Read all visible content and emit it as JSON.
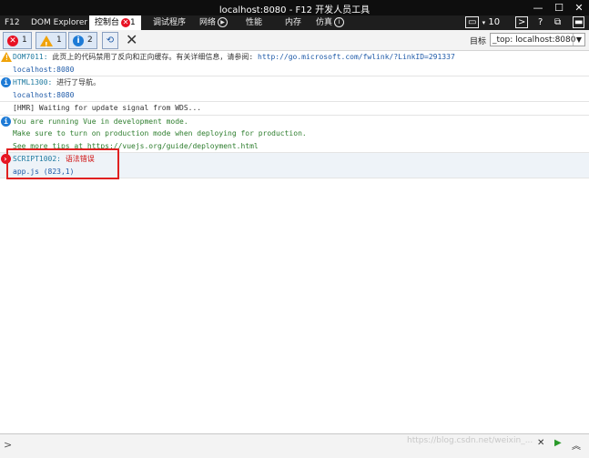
{
  "window": {
    "title": "localhost:8080 - F12 开发人员工具",
    "controls": {
      "minimize": "—",
      "maximize": "☐",
      "close": "✕"
    }
  },
  "tabs": {
    "items": [
      {
        "label": "F12"
      },
      {
        "label": "DOM Explorer"
      },
      {
        "label": "控制台",
        "badge": "1"
      },
      {
        "label": "调试程序"
      },
      {
        "label": "网络"
      },
      {
        "label": "性能"
      },
      {
        "label": "内存"
      },
      {
        "label": "仿真"
      }
    ],
    "emulation_mode": "10",
    "help": "?"
  },
  "toolbar": {
    "errors_count": "1",
    "warnings_count": "1",
    "info_count": "2",
    "target_label": "目标",
    "target_value": "_top: localhost:8080"
  },
  "console": {
    "messages": [
      {
        "type": "warning",
        "code": "DOM7011",
        "text": "此页上的代码禁用了反向和正向缓存。有关详细信息，请参阅:",
        "link": "http://go.microsoft.com/fwlink/?LinkID=291337",
        "source": "localhost:8080"
      },
      {
        "type": "info",
        "code": "HTML1300",
        "text": "进行了导航。",
        "source": "localhost:8080"
      },
      {
        "type": "log",
        "text": "[HMR] Waiting for update signal from WDS..."
      },
      {
        "type": "info",
        "lines": [
          "You are running Vue in development mode.",
          "Make sure to turn on production mode when deploying for production.",
          "See more tips at https://vuejs.org/guide/deployment.html"
        ]
      },
      {
        "type": "error",
        "code": "SCRIPT1002",
        "text": "语法错误",
        "source": "app.js (823,1)"
      }
    ]
  },
  "inputbar": {
    "prompt": ">",
    "watermark": "https://blog.csdn.net/weixin_..."
  },
  "colors": {
    "titlebar_bg": "#0e0e0e",
    "tabbar_bg": "#1e1e1e",
    "error_red": "#e81123",
    "warning_orange": "#f0a30a",
    "info_blue": "#1e7bd6",
    "highlight_box": "#e02020"
  }
}
